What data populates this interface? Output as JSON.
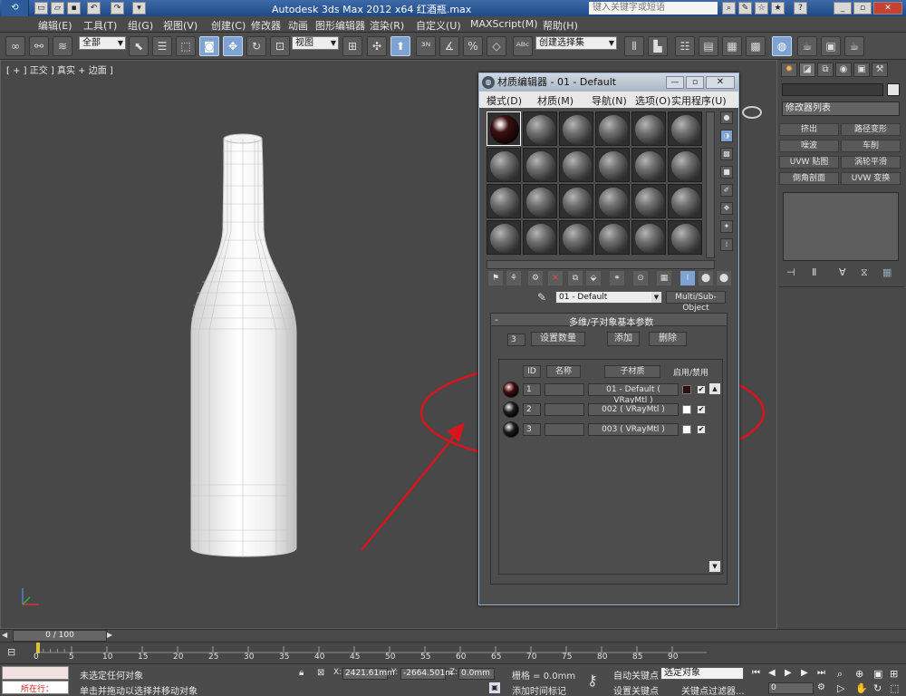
{
  "window": {
    "title": "Autodesk 3ds Max  2012 x64      红酒瓶.max",
    "search_placeholder": "键入关键字或短语"
  },
  "menu": [
    "编辑(E)",
    "工具(T)",
    "组(G)",
    "视图(V)",
    "创建(C)",
    "修改器",
    "动画",
    "图形编辑器",
    "渲染(R)",
    "自定义(U)",
    "MAXScript(M)",
    "帮助(H)"
  ],
  "toolbar": {
    "selection_filter": "全部",
    "ref_coord": "视图",
    "named_selection": "创建选择集"
  },
  "viewport": {
    "label": "[ + ] 正交 ] 真实 + 边面 ]"
  },
  "command_panel": {
    "modifier_list": "修改器列表",
    "buttons": [
      "挤出",
      "路径变形",
      "噪波",
      "车削",
      "UVW 贴图",
      "涡轮平滑",
      "倒角剖面",
      "UVW 变换"
    ]
  },
  "material_editor": {
    "title": "材质编辑器 - 01 - Default",
    "menu": [
      "模式(D)",
      "材质(M)",
      "导航(N)",
      "选项(O)",
      "实用程序(U)"
    ],
    "current_material": "01 - Default",
    "material_type": "Multi/Sub-Object",
    "rollout_title": "多维/子对象基本参数",
    "count": "3",
    "set_count_label": "设置数量",
    "add_label": "添加",
    "delete_label": "删除",
    "headers": {
      "id": "ID",
      "name": "名称",
      "sub_material": "子材质",
      "onoff": "启用/禁用"
    },
    "rows": [
      {
        "id": "1",
        "name": "",
        "sub_material": "01 - Default  ( VRayMtl )",
        "swatch": "#2a1010",
        "sphere": "dark-red-glossy-sphere"
      },
      {
        "id": "2",
        "name": "",
        "sub_material": "002  ( VRayMtl )",
        "swatch": "#ffffff",
        "sphere": "black-glossy-sphere"
      },
      {
        "id": "3",
        "name": "",
        "sub_material": "003  ( VRayMtl )",
        "swatch": "#ffffff",
        "sphere": "black-glossy-sphere"
      }
    ]
  },
  "timeline": {
    "frame": "0 / 100",
    "ticks": [
      "0",
      "5",
      "10",
      "15",
      "20",
      "25",
      "30",
      "35",
      "40",
      "45",
      "50",
      "55",
      "60",
      "65",
      "70",
      "75",
      "80",
      "85",
      "90"
    ]
  },
  "status": {
    "selected": "所在行：",
    "message1": "未选定任何对象",
    "message2": "单击并拖动以选择并移动对象",
    "x_label": "X:",
    "x": "2421.61mm",
    "y_label": "Y:",
    "y": "-2664.501m",
    "z_label": "Z:",
    "z": "0.0mm",
    "grid": "栅格 = 0.0mm",
    "auto_key": "自动关键点",
    "auto_key_mode": "选定对象",
    "set_key": "设置关键点",
    "key_filters": "关键点过滤器...",
    "add_time_tag": "添加时间标记",
    "frame_field": "0"
  },
  "colors": {
    "annotation": "#d8141c",
    "viewport_bg": "#484848",
    "active_tool": "#7ea3d3"
  }
}
